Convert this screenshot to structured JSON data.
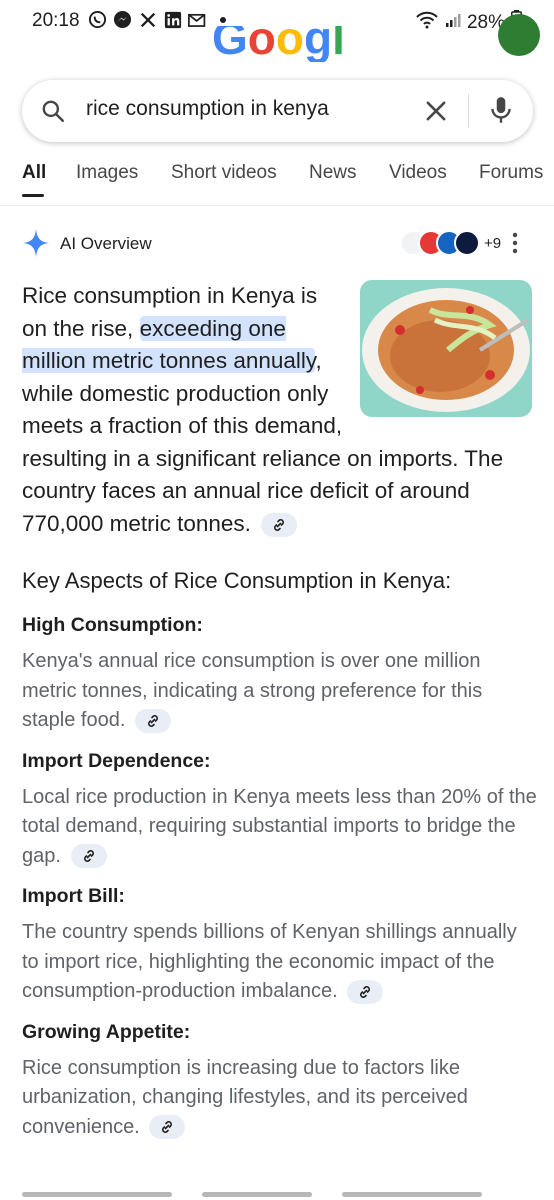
{
  "status_bar": {
    "time": "20:18",
    "battery": "28%",
    "icons": [
      "whatsapp-icon",
      "messenger-icon",
      "x-icon",
      "linkedin-icon",
      "email-icon",
      "dot-icon"
    ]
  },
  "search": {
    "query": "rice consumption in kenya"
  },
  "tabs": [
    {
      "label": "All"
    },
    {
      "label": "Images"
    },
    {
      "label": "Short videos"
    },
    {
      "label": "News"
    },
    {
      "label": "Videos"
    },
    {
      "label": "Forums"
    }
  ],
  "ai_overview": {
    "title": "AI Overview",
    "source_count": "+9",
    "answer_pre": "Rice consumption in Kenya is on the rise, ",
    "answer_highlight": "exceeding one million metric tonnes annually",
    "answer_post": ", while domestic production only meets a fraction of this demand, resulting in a significant reliance on imports. The country faces an annual rice deficit of around 770,000 metric tonnes.",
    "key_heading": "Key Aspects of Rice Consumption in Kenya:",
    "aspects": [
      {
        "title": "High Consumption:",
        "body": "Kenya's annual rice consumption is over one million metric tonnes, indicating a strong preference for this staple food."
      },
      {
        "title": "Import Dependence:",
        "body": "Local rice production in Kenya meets less than 20% of the total demand, requiring substantial imports to bridge the gap."
      },
      {
        "title": "Import Bill:",
        "body": "The country spends billions of Kenyan shillings annually to import rice, highlighting the economic impact of the consumption-production imbalance."
      },
      {
        "title": "Growing Appetite:",
        "body": "Rice consumption is increasing due to factors like urbanization, changing lifestyles, and its perceived convenience."
      }
    ]
  },
  "colors": {
    "highlight": "#d3e3fd",
    "muted_text": "#5f6368",
    "chip": "#e9eef6",
    "ai_blue": "#4285f4"
  }
}
